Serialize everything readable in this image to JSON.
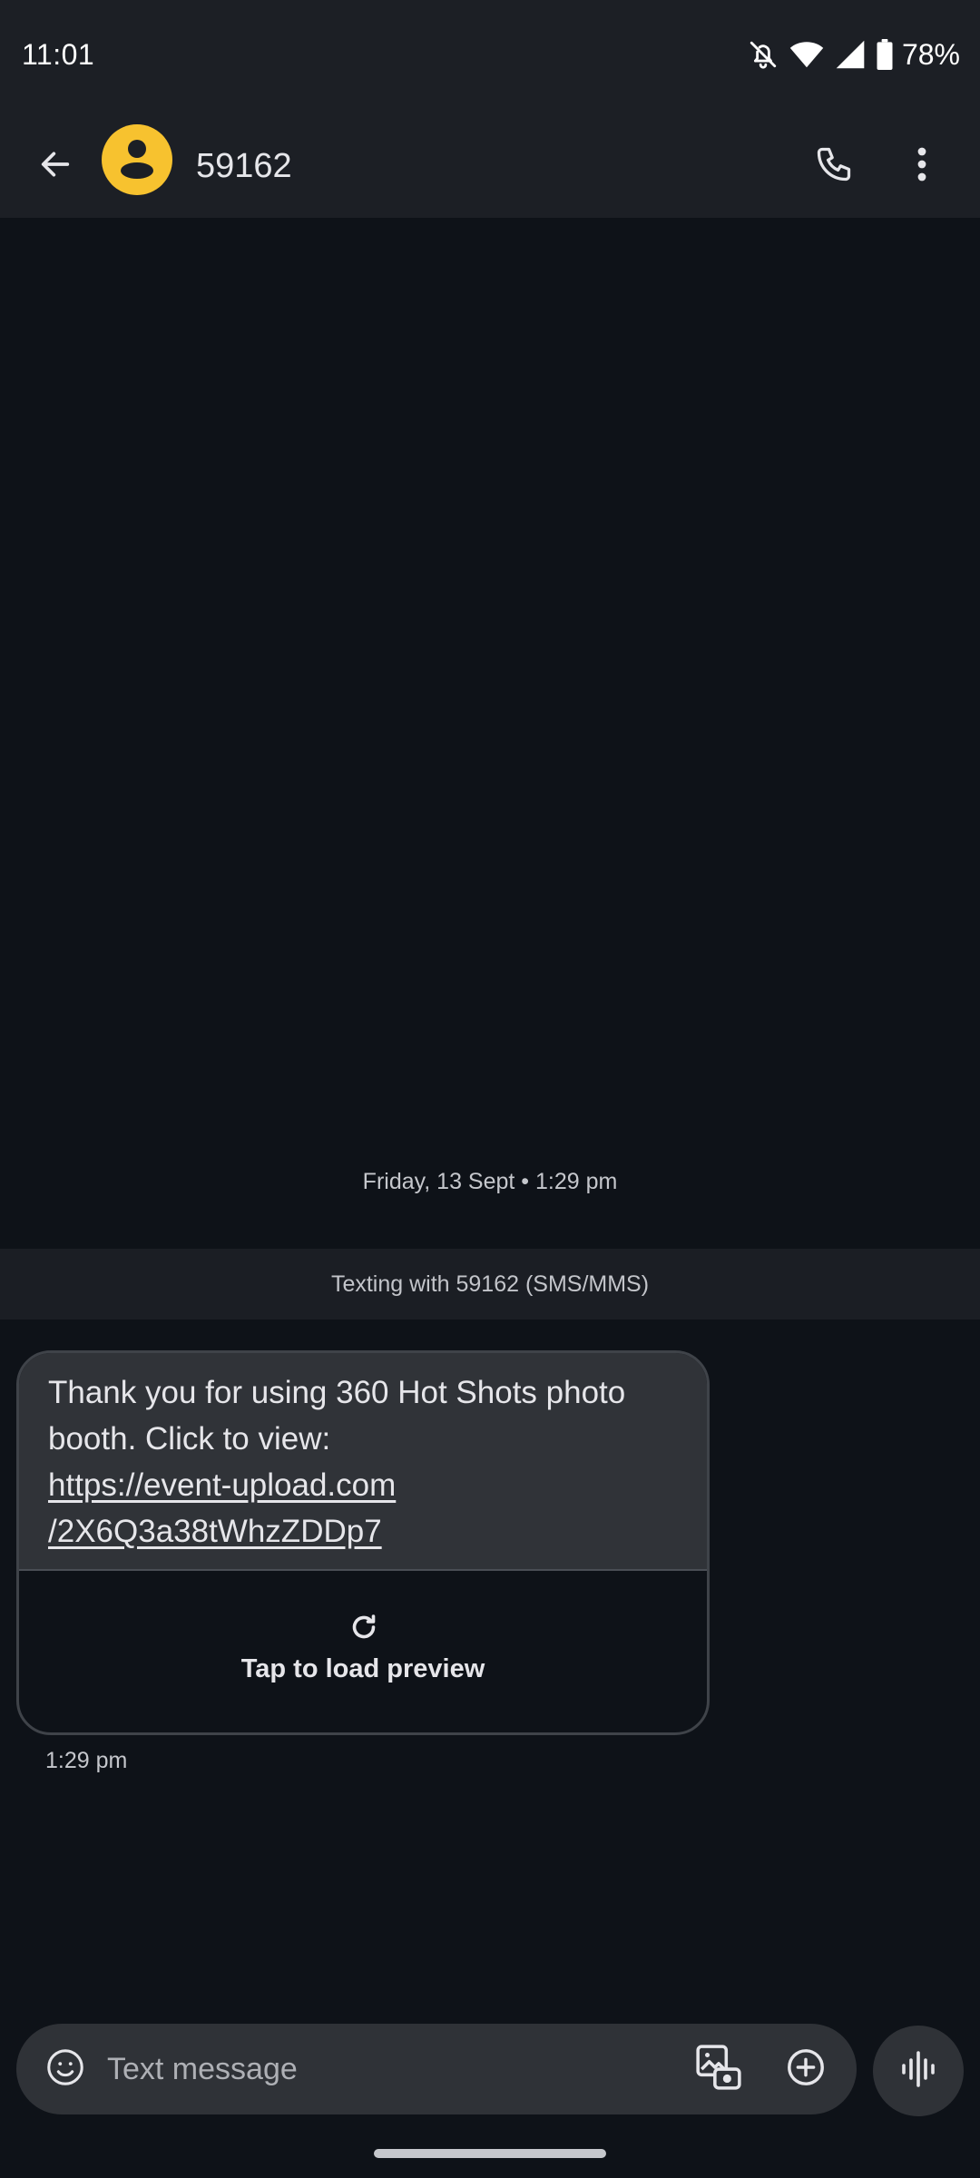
{
  "status_bar": {
    "time": "11:01",
    "battery_percent": "78%",
    "icons": [
      "notifications-off-icon",
      "wifi-icon",
      "cell-signal-icon",
      "battery-icon"
    ]
  },
  "app_bar": {
    "contact_name": "59162",
    "icons": [
      "back-arrow-icon",
      "avatar-person-icon",
      "phone-icon",
      "more-vert-icon"
    ],
    "avatar_color": "#f7c22f"
  },
  "conversation": {
    "date_header": "Friday, 13 Sept • 1:29 pm",
    "texting_banner": "Texting with 59162 (SMS/MMS)",
    "messages": [
      {
        "text_before_link": "Thank you for using 360 Hot Shots photo booth. Click to view: ",
        "link_line1": "https://event-upload.com",
        "link_line2": "/2X6Q3a38tWhzZDDp7",
        "preview_label": "Tap to load preview",
        "time": "1:29 pm"
      }
    ]
  },
  "compose": {
    "placeholder": "Text message",
    "value": "",
    "icons": [
      "emoji-icon",
      "gallery-camera-icon",
      "add-circle-icon",
      "voice-waveform-icon"
    ]
  },
  "colors": {
    "background": "#0e1218",
    "app_bar": "#1c1f25",
    "bubble": "#303338",
    "compose": "#2f3237"
  }
}
